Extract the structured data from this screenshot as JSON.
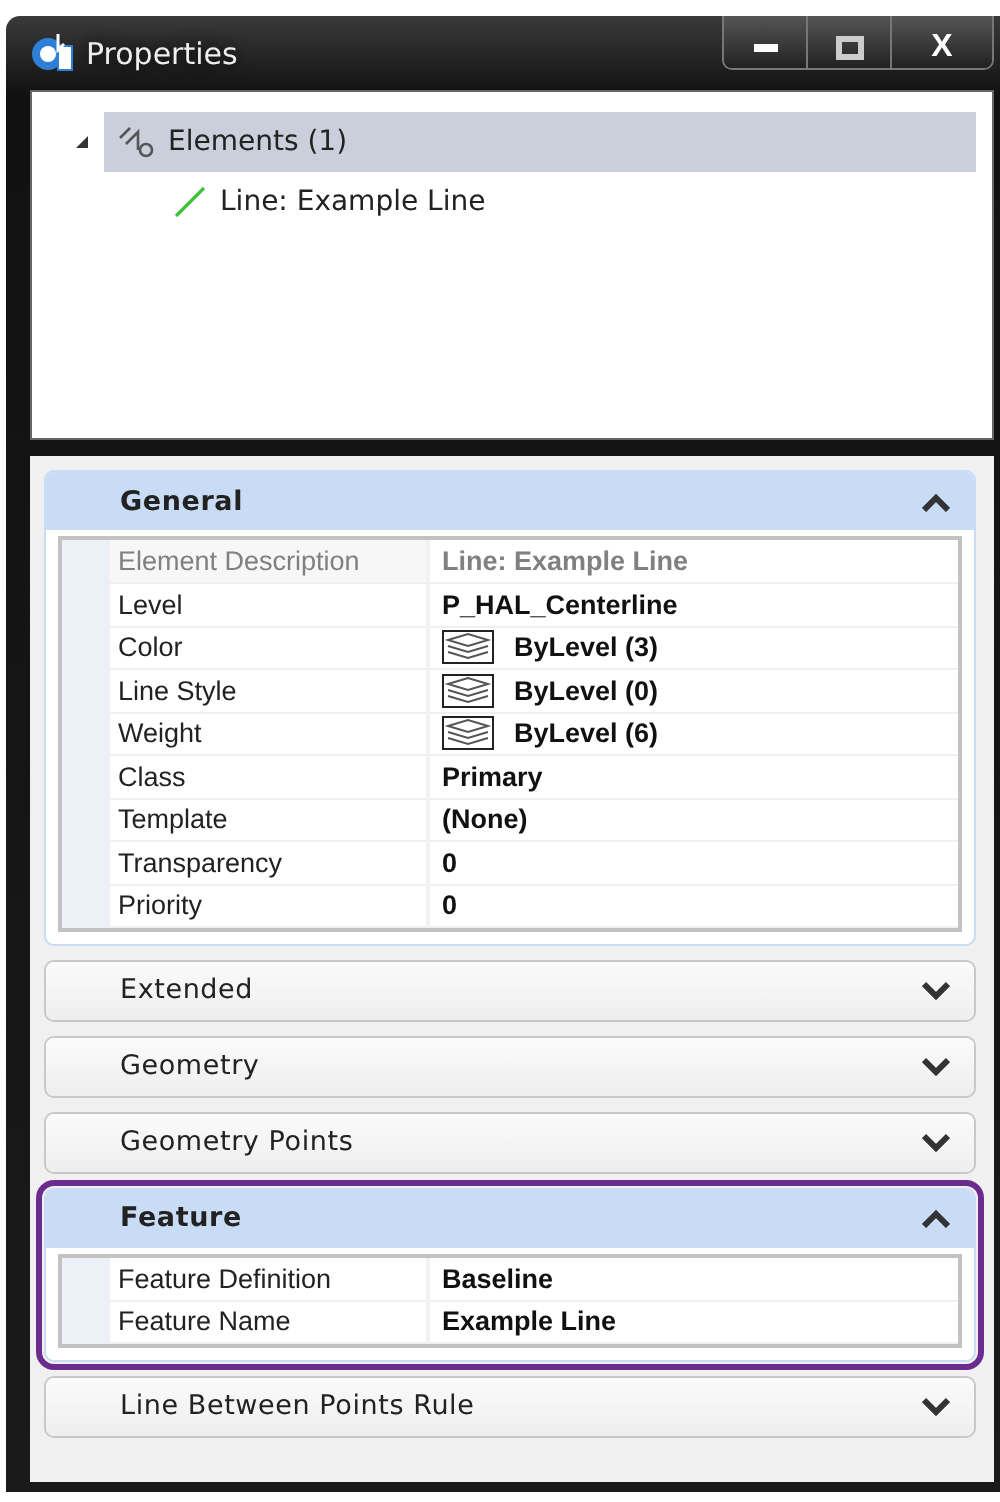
{
  "window": {
    "title": "Properties",
    "buttons": [
      {
        "kind": "minimize"
      },
      {
        "kind": "maximize"
      },
      {
        "kind": "close",
        "label": "X"
      }
    ]
  },
  "tree": [
    {
      "label": "Elements (1)",
      "selected": true,
      "expanded": true,
      "children": [
        {
          "label": "Line: Example Line",
          "selected": false
        }
      ]
    }
  ],
  "sections": [
    {
      "title": "General",
      "expanded": true,
      "highlighted": false,
      "rows": [
        {
          "label": "Element Description",
          "value": "Line: Example Line",
          "disabled": true,
          "kind": "text"
        },
        {
          "label": "Level",
          "value": "P_HAL_Centerline",
          "disabled": false,
          "kind": "text"
        },
        {
          "label": "Color",
          "value": "ByLevel (3)",
          "disabled": false,
          "kind": "swatch"
        },
        {
          "label": "Line Style",
          "value": "ByLevel (0)",
          "disabled": false,
          "kind": "swatch"
        },
        {
          "label": "Weight",
          "value": "ByLevel (6)",
          "disabled": false,
          "kind": "swatch"
        },
        {
          "label": "Class",
          "value": "Primary",
          "disabled": false,
          "kind": "text"
        },
        {
          "label": "Template",
          "value": "(None)",
          "disabled": false,
          "kind": "text"
        },
        {
          "label": "Transparency",
          "value": "0",
          "disabled": false,
          "kind": "text"
        },
        {
          "label": "Priority",
          "value": "0",
          "disabled": false,
          "kind": "text"
        }
      ]
    },
    {
      "title": "Extended",
      "expanded": false,
      "highlighted": false
    },
    {
      "title": "Geometry",
      "expanded": false,
      "highlighted": false
    },
    {
      "title": "Geometry Points",
      "expanded": false,
      "highlighted": false
    },
    {
      "title": "Feature",
      "expanded": true,
      "highlighted": true,
      "rows": [
        {
          "label": "Feature Definition",
          "value": "Baseline",
          "disabled": false,
          "kind": "text"
        },
        {
          "label": "Feature Name",
          "value": "Example Line",
          "disabled": false,
          "kind": "text"
        }
      ]
    },
    {
      "title": "Line Between Points Rule",
      "expanded": false,
      "highlighted": false
    }
  ]
}
